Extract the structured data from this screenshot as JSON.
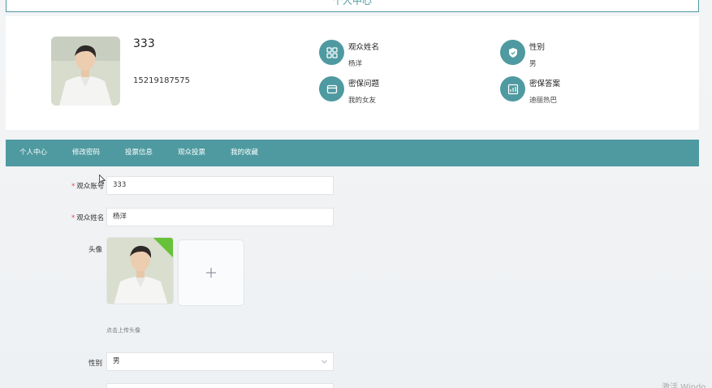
{
  "page": {
    "title": "个人中心"
  },
  "profile": {
    "username": "333",
    "phone": "15219187575",
    "fields": [
      {
        "label": "观众姓名",
        "value": "杨洋",
        "icon": "grid-icon"
      },
      {
        "label": "性别",
        "value": "男",
        "icon": "shield-icon"
      },
      {
        "label": "密保问题",
        "value": "我的女友",
        "icon": "card-icon"
      },
      {
        "label": "密保答案",
        "value": "迪丽热巴",
        "icon": "chart-icon"
      }
    ]
  },
  "tabs": [
    {
      "label": "个人中心",
      "active": true
    },
    {
      "label": "修改密码"
    },
    {
      "label": "投票信息"
    },
    {
      "label": "观众投票"
    },
    {
      "label": "我的收藏"
    }
  ],
  "form": {
    "account": {
      "label": "观众账号",
      "required": "*",
      "value": "333"
    },
    "name": {
      "label": "观众姓名",
      "required": "*",
      "value": "杨洋"
    },
    "avatar": {
      "label": "头像",
      "hint": "点击上传头像"
    },
    "gender": {
      "label": "性别",
      "value": "男"
    }
  },
  "colors": {
    "accent": "#4e9aa0",
    "success": "#67c23a",
    "required": "#e5484d"
  },
  "watermark": "激活 Windo"
}
